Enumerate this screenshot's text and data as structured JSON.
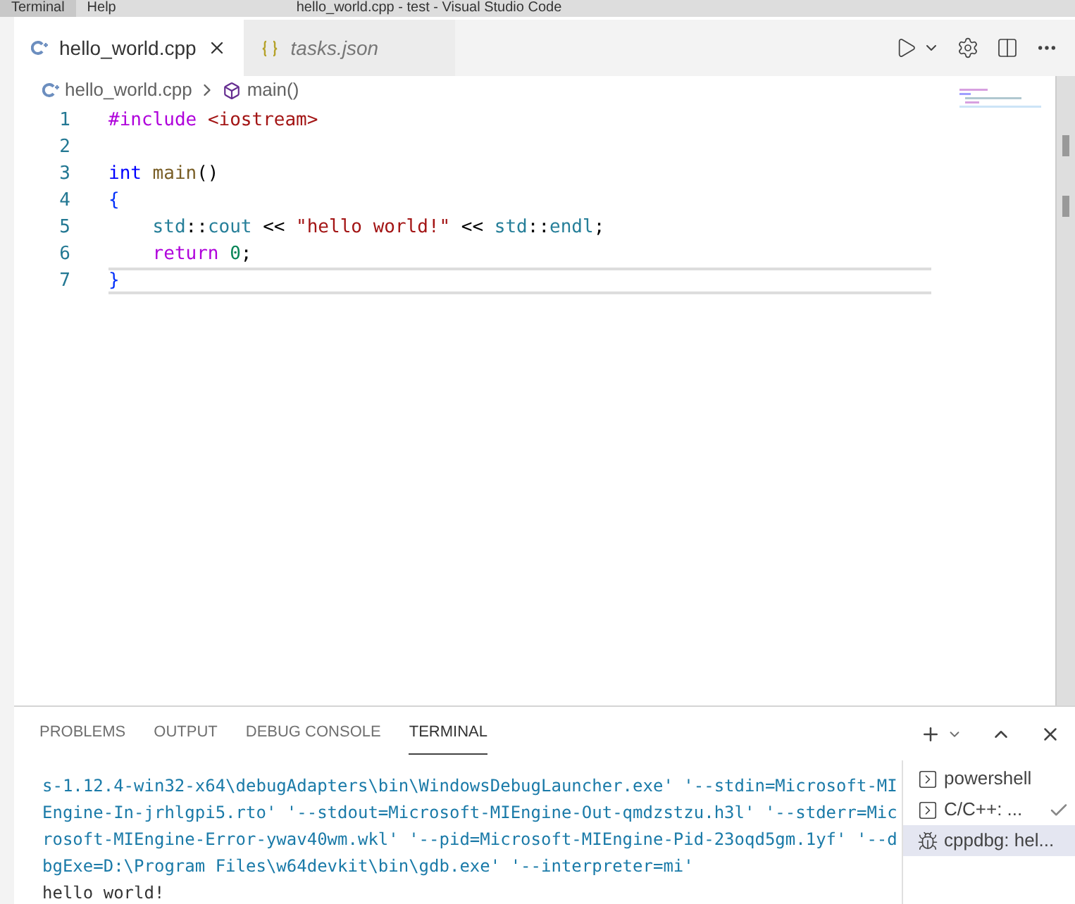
{
  "menu": [
    "Terminal",
    "Help"
  ],
  "window": {
    "title": "hello_world.cpp - test - Visual Studio Code"
  },
  "tabs": [
    {
      "label": "hello_world.cpp",
      "kind": "cpp",
      "selected": true,
      "italic": false
    },
    {
      "label": "tasks.json",
      "kind": "json",
      "selected": false,
      "italic": true
    }
  ],
  "breadcrumb": {
    "file": "hello_world.cpp",
    "symbol": "main()"
  },
  "code": {
    "lines": [
      {
        "number": "1",
        "current": false,
        "indented": false,
        "tokens": [
          {
            "kind": "directive",
            "text": "#include"
          },
          {
            "kind": "header",
            "text": "<iostream>",
            "space_before": true
          }
        ]
      },
      {
        "number": "2",
        "current": false,
        "indented": false
      },
      {
        "number": "3",
        "current": false,
        "indented": false,
        "tokens": [
          {
            "kind": "keyword",
            "text": "int"
          },
          {
            "kind": "function",
            "text": "main",
            "space_before": true
          },
          {
            "kind": "plain",
            "text": "()"
          }
        ]
      },
      {
        "number": "4",
        "current": false,
        "indented": false,
        "tokens": [
          {
            "kind": "bracket",
            "text": "{"
          }
        ]
      },
      {
        "number": "5",
        "current": false,
        "indented": true,
        "tokens": [
          {
            "kind": "namespace",
            "text": "std"
          },
          {
            "kind": "plain",
            "text": "::"
          },
          {
            "kind": "namespace",
            "text": "cout"
          },
          {
            "kind": "plain",
            "text": "<<",
            "space_before": true
          },
          {
            "kind": "string",
            "text": "\"hello world!\"",
            "space_before": true
          },
          {
            "kind": "plain",
            "text": "<<",
            "space_before": true
          },
          {
            "kind": "namespace",
            "text": "std",
            "space_before": true
          },
          {
            "kind": "plain",
            "text": "::"
          },
          {
            "kind": "namespace",
            "text": "endl"
          },
          {
            "kind": "plain",
            "text": ";"
          }
        ]
      },
      {
        "number": "6",
        "current": false,
        "indented": true,
        "tokens": [
          {
            "kind": "control",
            "text": "return"
          },
          {
            "kind": "number",
            "text": "0",
            "space_before": true
          },
          {
            "kind": "plain",
            "text": ";"
          }
        ]
      },
      {
        "number": "7",
        "current": true,
        "indented": false,
        "tokens": [
          {
            "kind": "bracket",
            "text": "}"
          }
        ]
      }
    ]
  },
  "panel": {
    "tabs": [
      {
        "label": "PROBLEMS",
        "selected": false
      },
      {
        "label": "OUTPUT",
        "selected": false
      },
      {
        "label": "DEBUG CONSOLE",
        "selected": false
      },
      {
        "label": "TERMINAL",
        "selected": true
      }
    ],
    "terminal_lines": [
      {
        "kind": "command",
        "text": "s-1.12.4-win32-x64\\debugAdapters\\bin\\WindowsDebugLauncher.exe' '--stdin=Microsoft-MI"
      },
      {
        "kind": "command",
        "text": "Engine-In-jrhlgpi5.rto' '--stdout=Microsoft-MIEngine-Out-qmdzstzu.h3l' '--stderr=Mic"
      },
      {
        "kind": "command",
        "text": "rosoft-MIEngine-Error-ywav40wm.wkl' '--pid=Microsoft-MIEngine-Pid-23oqd5gm.1yf' '--d"
      },
      {
        "kind": "command",
        "text": "bgExe=D:\\Program Files\\w64devkit\\bin\\gdb.exe' '--interpreter=mi'"
      },
      {
        "kind": "output",
        "text": "hello world!"
      }
    ],
    "terminals": [
      {
        "label": "powershell",
        "kind": "shell",
        "selected": false,
        "done": false
      },
      {
        "label": "C/C++: ...",
        "kind": "shell",
        "selected": false,
        "done": true
      },
      {
        "label": "cppdbg: hel...",
        "kind": "debug",
        "selected": true,
        "done": false
      }
    ]
  }
}
